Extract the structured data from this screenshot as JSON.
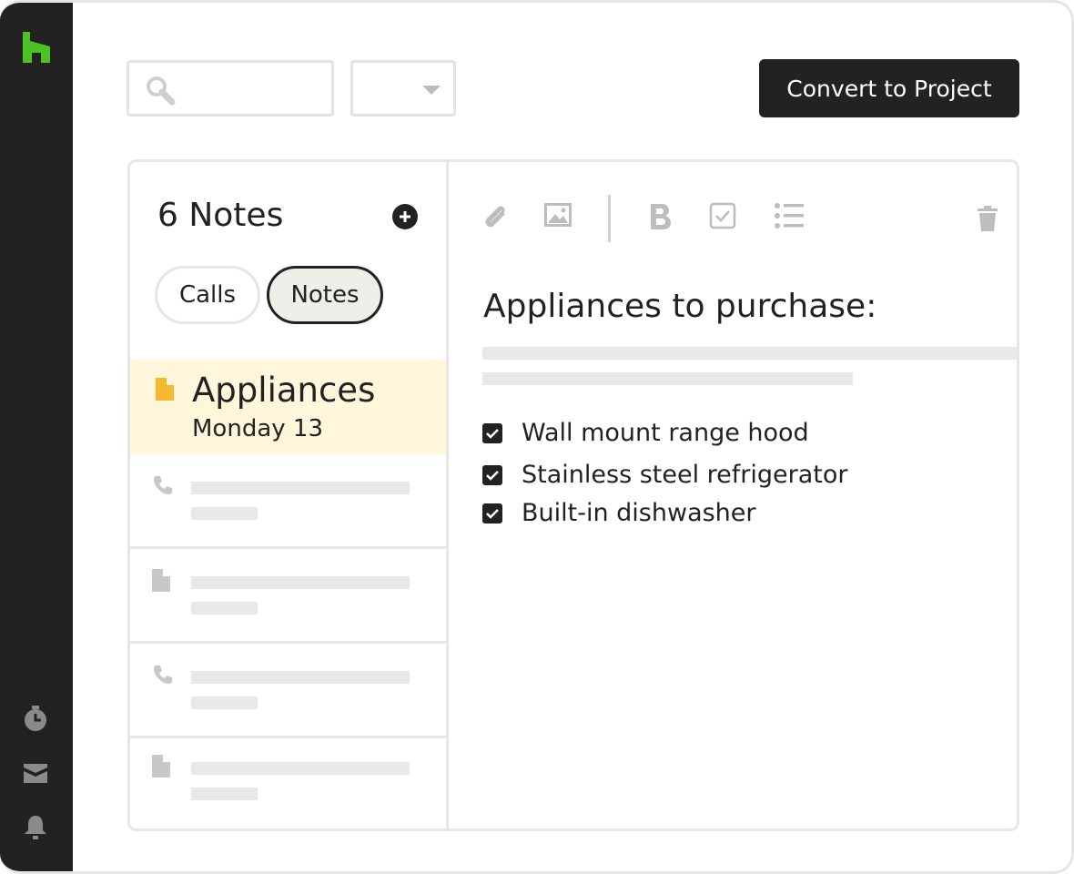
{
  "toolbar": {
    "convert_label": "Convert to Project"
  },
  "notes_panel": {
    "title": "6 Notes",
    "tabs": [
      {
        "label": "Calls",
        "active": false
      },
      {
        "label": "Notes",
        "active": true
      }
    ],
    "active_note": {
      "title": "Appliances",
      "date": "Monday 13"
    },
    "placeholder_rows": [
      {
        "icon": "phone-icon"
      },
      {
        "icon": "document-icon"
      },
      {
        "icon": "phone-icon"
      },
      {
        "icon": "document-icon"
      }
    ]
  },
  "editor": {
    "heading": "Appliances to purchase:",
    "checklist": [
      {
        "label": "Wall mount range hood",
        "checked": true
      },
      {
        "label": "Stainless steel refrigerator",
        "checked": true
      },
      {
        "label": "Built-in dishwasher",
        "checked": true
      }
    ],
    "tools": [
      "attachment-icon",
      "image-icon",
      "bold-icon",
      "checkbox-icon",
      "bullet-list-icon",
      "trash-icon"
    ]
  },
  "colors": {
    "rail": "#222222",
    "logo": "#4dc321",
    "active_note_bg": "#fff6dc",
    "note_icon": "#f5b82e"
  }
}
